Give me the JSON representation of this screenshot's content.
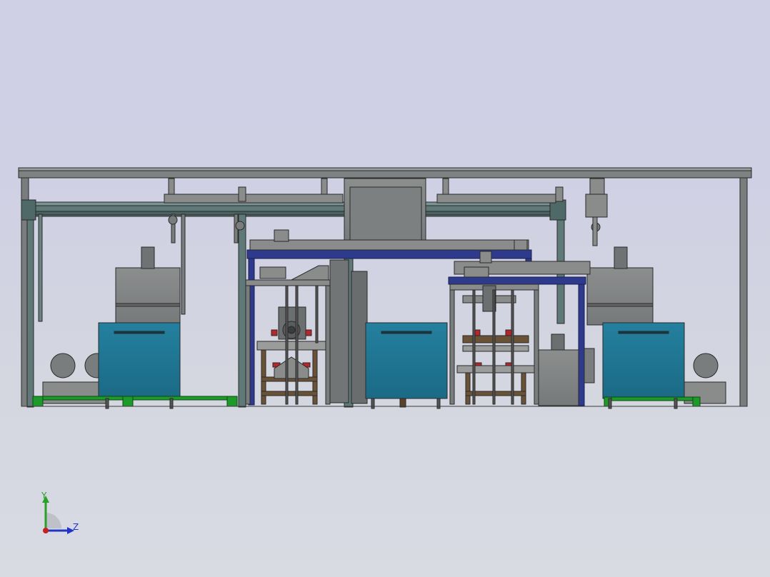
{
  "viewport": {
    "background_top": "#cfd0e6",
    "background_bottom": "#d8dbe2",
    "colors": {
      "frame_gray": "#7a7d7e",
      "frame_dark": "#5e6262",
      "beam_teal": "#5f7878",
      "rail_blue": "#2e3a8c",
      "tank_teal": "#1f7390",
      "machine_gray": "#8a8b8b",
      "pallet_green": "#1e9a2a",
      "wood_brown": "#6a5236",
      "accent_red": "#b8252b",
      "outline": "#2a2a2a"
    },
    "description_icon": "cad-assembly-drawing"
  },
  "triad": {
    "y_label": "Y",
    "z_label": "Z",
    "y_color": "#2aa02a",
    "z_color": "#2034c8",
    "x_color": "#c82020"
  }
}
